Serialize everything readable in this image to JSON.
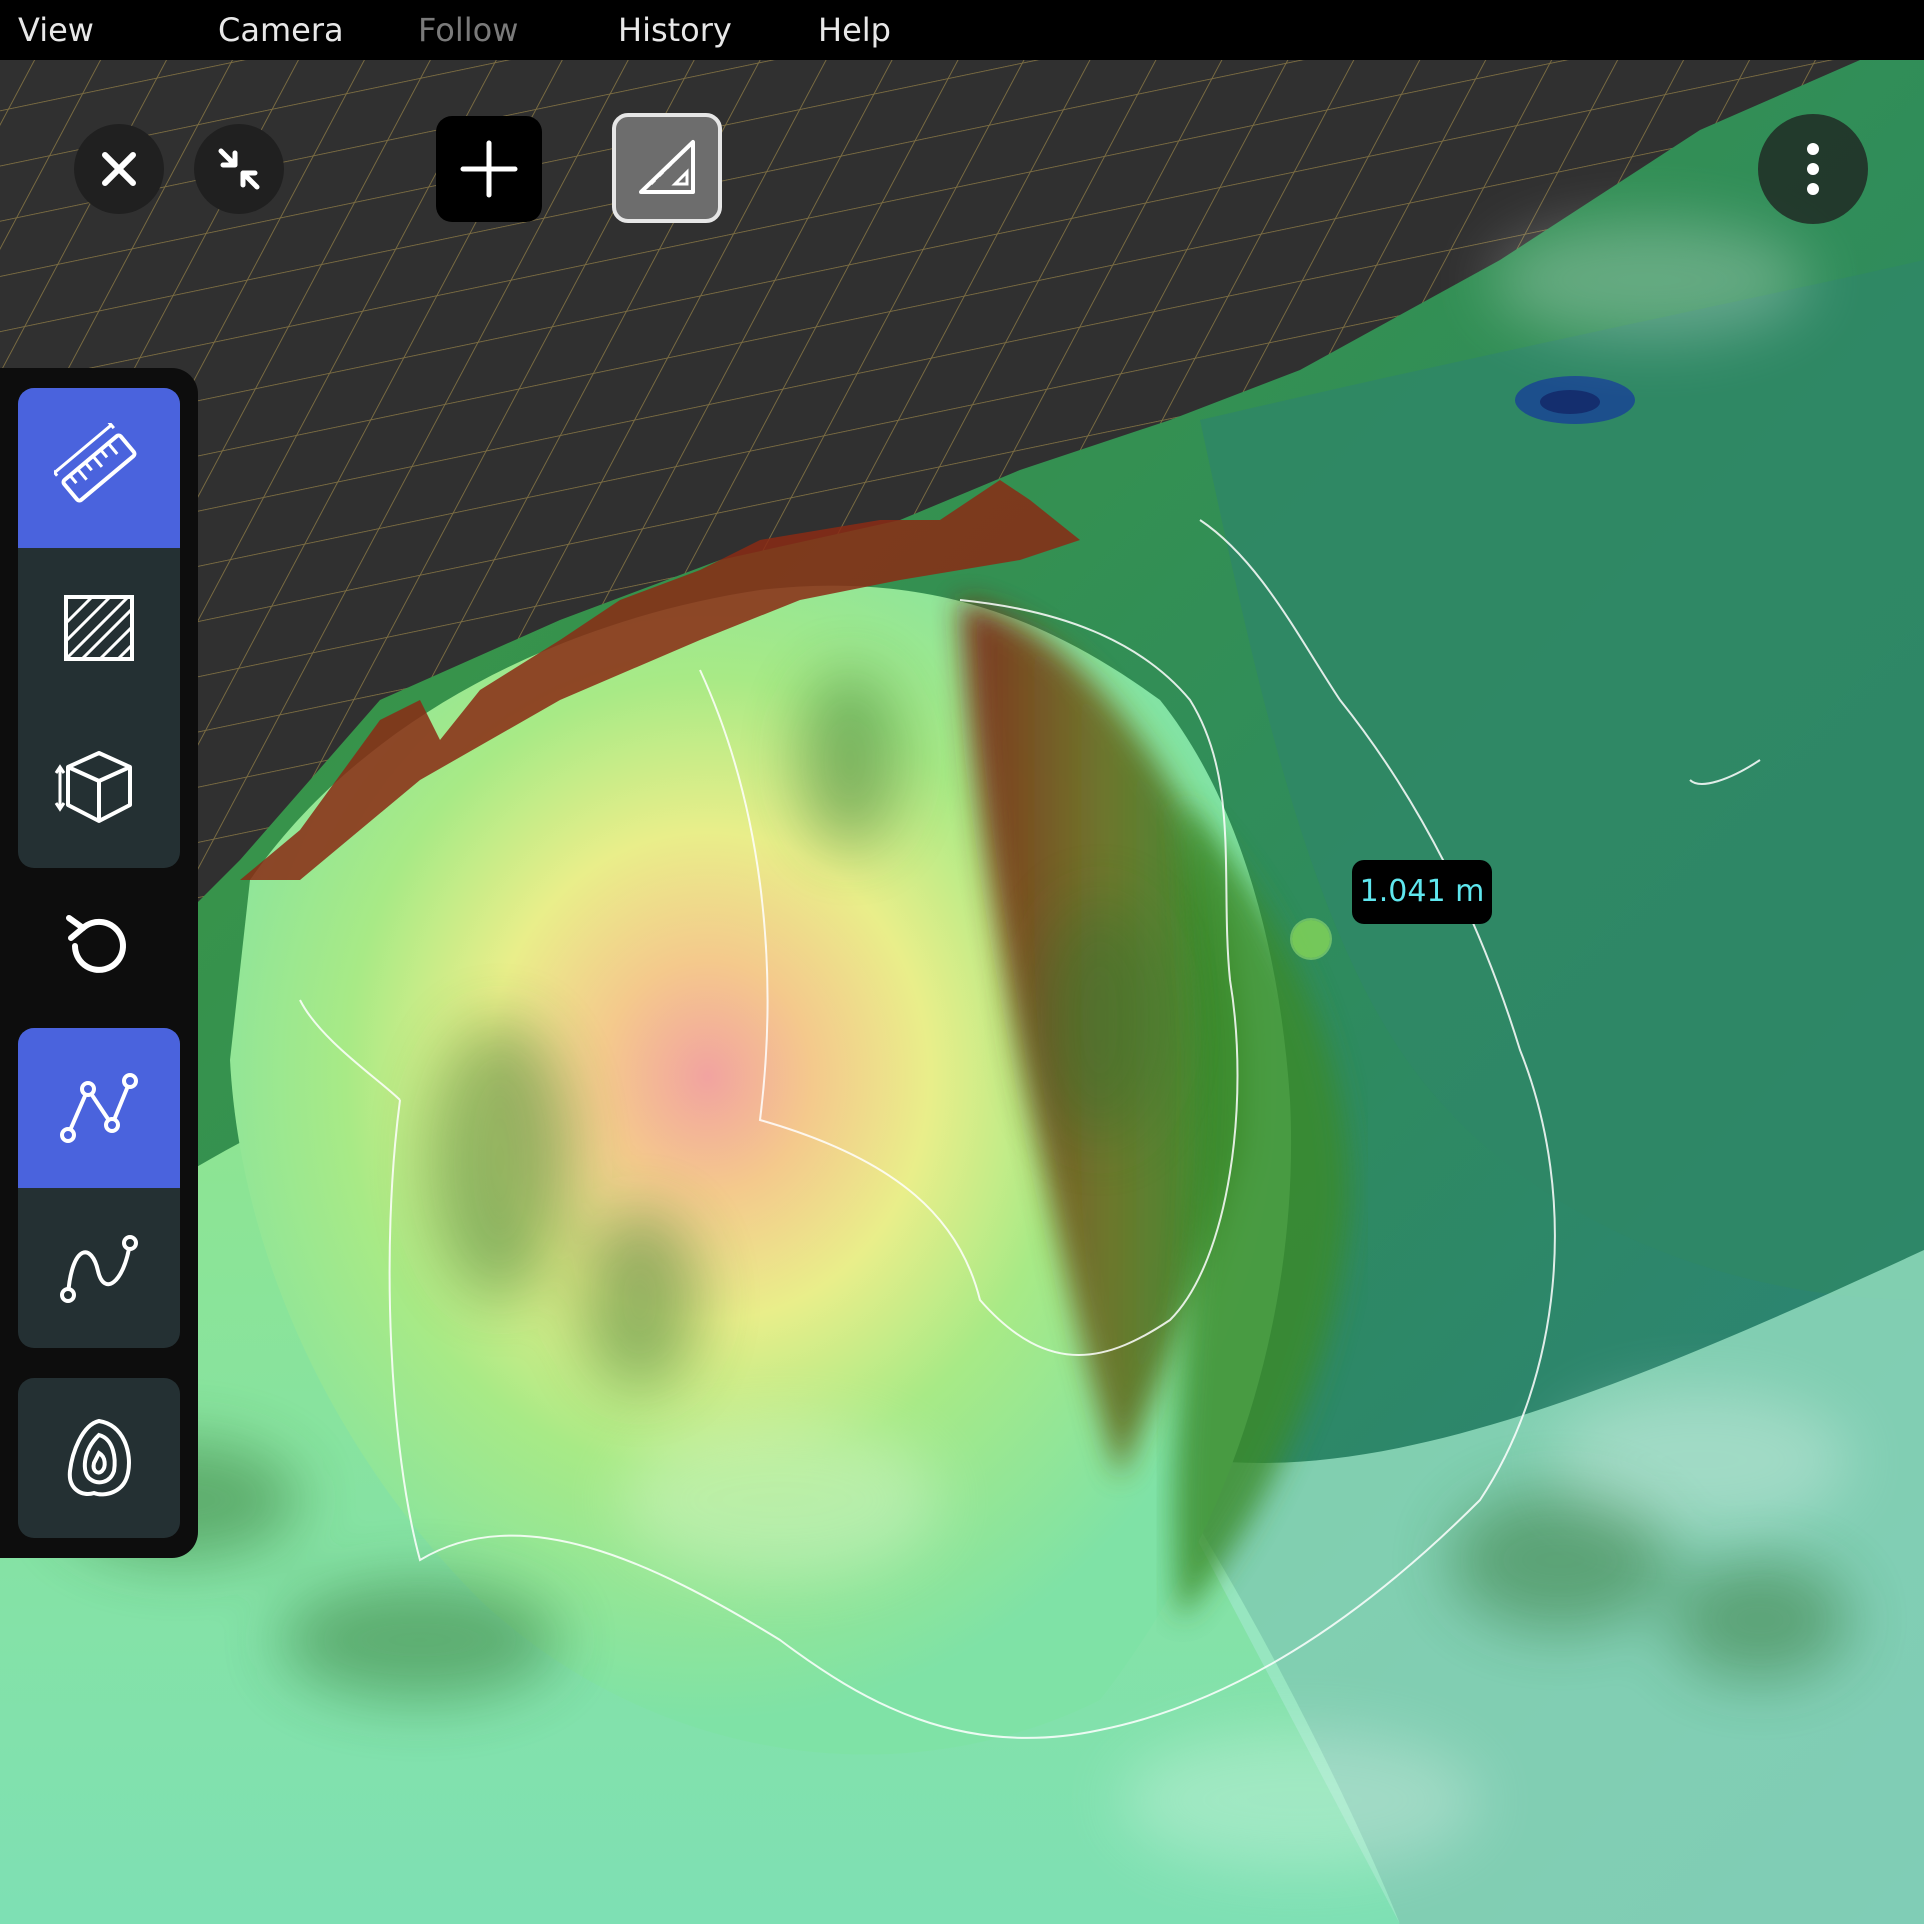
{
  "menu": {
    "view": "View",
    "camera": "Camera",
    "follow": "Follow",
    "history": "History",
    "help": "Help"
  },
  "top_controls": {
    "close_icon": "close-icon",
    "collapse_icon": "collapse-arrows-icon",
    "add_icon": "plus-icon",
    "measure_mode_icon": "triangle-ruler-icon",
    "more_icon": "vertical-dots-icon"
  },
  "tools": {
    "distance": {
      "icon": "ruler-icon",
      "active": true
    },
    "area": {
      "icon": "hatched-area-icon",
      "active": false
    },
    "volume": {
      "icon": "cube-icon",
      "active": false
    },
    "reset": {
      "icon": "rotate-ccw-icon",
      "active": false
    },
    "polyline": {
      "icon": "polyline-icon",
      "active": true
    },
    "curve": {
      "icon": "curve-icon",
      "active": false
    },
    "contour": {
      "icon": "contour-icon",
      "active": false
    }
  },
  "measurement": {
    "label": "1.041 m"
  },
  "colors": {
    "accent": "#4a63dd",
    "measure_text": "#5fe6ee",
    "grid": "#8a7a45",
    "background": "#303030"
  }
}
